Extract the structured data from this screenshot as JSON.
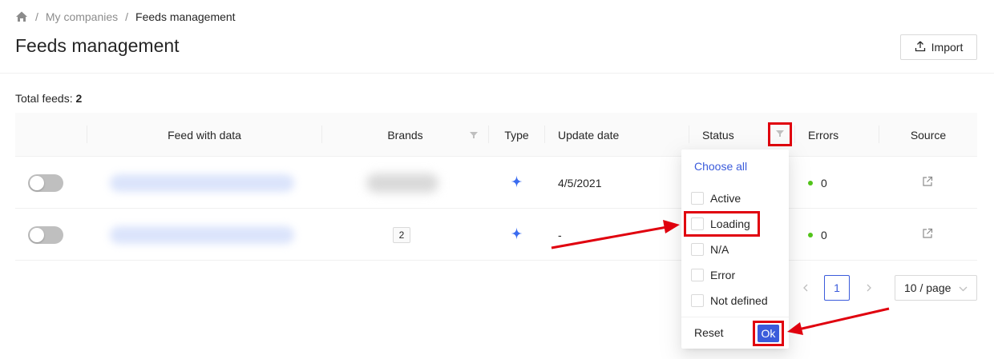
{
  "breadcrumb": {
    "home_icon": "home-icon",
    "items": [
      "My companies",
      "Feeds management"
    ]
  },
  "header": {
    "title": "Feeds management",
    "import_label": "Import",
    "import_icon": "upload-icon"
  },
  "summary": {
    "label": "Total feeds: ",
    "count": "2"
  },
  "table": {
    "columns": {
      "feed": "Feed with data",
      "brands": "Brands",
      "type": "Type",
      "update": "Update date",
      "status": "Status",
      "errors": "Errors",
      "source": "Source"
    },
    "rows": [
      {
        "brands": "",
        "update_date": "4/5/2021",
        "errors": "0",
        "type_icon": "sparkle-icon",
        "source_icon": "external-link-icon"
      },
      {
        "brands": "2",
        "update_date": "-",
        "errors": "0",
        "type_icon": "sparkle-icon",
        "source_icon": "external-link-icon"
      }
    ]
  },
  "pagination": {
    "current": "1",
    "page_size": "10 / page"
  },
  "status_filter": {
    "choose_all": "Choose all",
    "options": [
      "Active",
      "Loading",
      "N/A",
      "Error",
      "Not defined"
    ],
    "reset": "Reset",
    "ok": "Ok"
  },
  "colors": {
    "accent": "#3b5bdb",
    "highlight": "#e0000e",
    "success": "#52c41a"
  }
}
